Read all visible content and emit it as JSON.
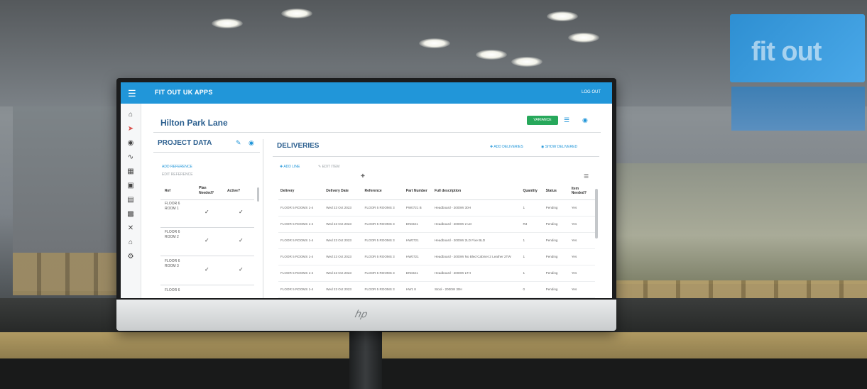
{
  "app": {
    "title": "FIT OUT UK APPS",
    "user": "LOG OUT",
    "menu_icon": "menu-icon"
  },
  "sidebar": {
    "icons": [
      "home-icon",
      "share-icon",
      "location-icon",
      "truck-icon",
      "hierarchy-icon",
      "calendar-icon",
      "document-icon",
      "chat-icon",
      "tools-icon",
      "house-icon",
      "settings-icon"
    ]
  },
  "page": {
    "title": "Hilton Park Lane",
    "badge": "VARIANCE"
  },
  "project_data": {
    "title": "PROJECT DATA",
    "add_link": "ADD REFERENCE",
    "edit_link": "EDIT REFERENCE",
    "columns": [
      "Ref",
      "Plan Needed?",
      "Active?"
    ],
    "rows": [
      {
        "ref": "FLOOR 6 ROOM 1"
      },
      {
        "ref": "FLOOR 6 ROOM 2"
      },
      {
        "ref": "FLOOR 6 ROOM 3"
      },
      {
        "ref": "FLOOR 6"
      }
    ]
  },
  "deliveries": {
    "title": "DELIVERIES",
    "add_deliveries": "ADD DELIVERIES",
    "show_delivered": "SHOW DELIVERED",
    "add_link": "ADD LINE",
    "edit_link": "EDIT ITEM",
    "columns": [
      "Delivery",
      "Delivery Date",
      "Reference",
      "Part Number",
      "Full description",
      "Quantity",
      "Status",
      "Item Needed?"
    ],
    "rows": [
      [
        "FLOOR 5 ROOMS 1-4",
        "Wed 23 Oct 2023",
        "FLOOR 5 ROOMS 3",
        "PW0721 B",
        "Headboard - 2000W 30H",
        "1",
        "Pending",
        "Yes"
      ],
      [
        "FLOOR 5 ROOMS 1-4",
        "Wed 23 Oct 2023",
        "FLOOR 5 ROOMS 3",
        "DN0321",
        "Headboard - 2000W 2 LD",
        "R3",
        "Pending",
        "Yes"
      ],
      [
        "FLOOR 5 ROOMS 1-4",
        "Wed 23 Oct 2023",
        "FLOOR 5 ROOMS 3",
        "HW0721",
        "Headboard - 2000W 2LD Fixe BLD",
        "1",
        "Pending",
        "Yes"
      ],
      [
        "FLOOR 5 ROOMS 1-4",
        "Wed 23 Oct 2023",
        "FLOOR 5 ROOMS 3",
        "HW0721",
        "Headboard - 2000W No Bled Cabinet 2 Leather 2TW",
        "1",
        "Pending",
        "Yes"
      ],
      [
        "FLOOR 5 ROOMS 1-4",
        "Wed 23 Oct 2023",
        "FLOOR 5 ROOMS 3",
        "DN0321",
        "Headboard - 2000W LTH",
        "1",
        "Pending",
        "Yes"
      ],
      [
        "FLOOR 5 ROOMS 1-4",
        "Wed 23 Oct 2023",
        "FLOOR 5 ROOMS 3",
        "HW1 8",
        "Stool - 2000W 30H",
        "0",
        "Pending",
        "Yes"
      ]
    ]
  },
  "background": {
    "sign_text": "fit out"
  },
  "colors": {
    "topbar": "#2196d9",
    "accent_title": "#2b5f8f",
    "badge": "#27a85b"
  }
}
